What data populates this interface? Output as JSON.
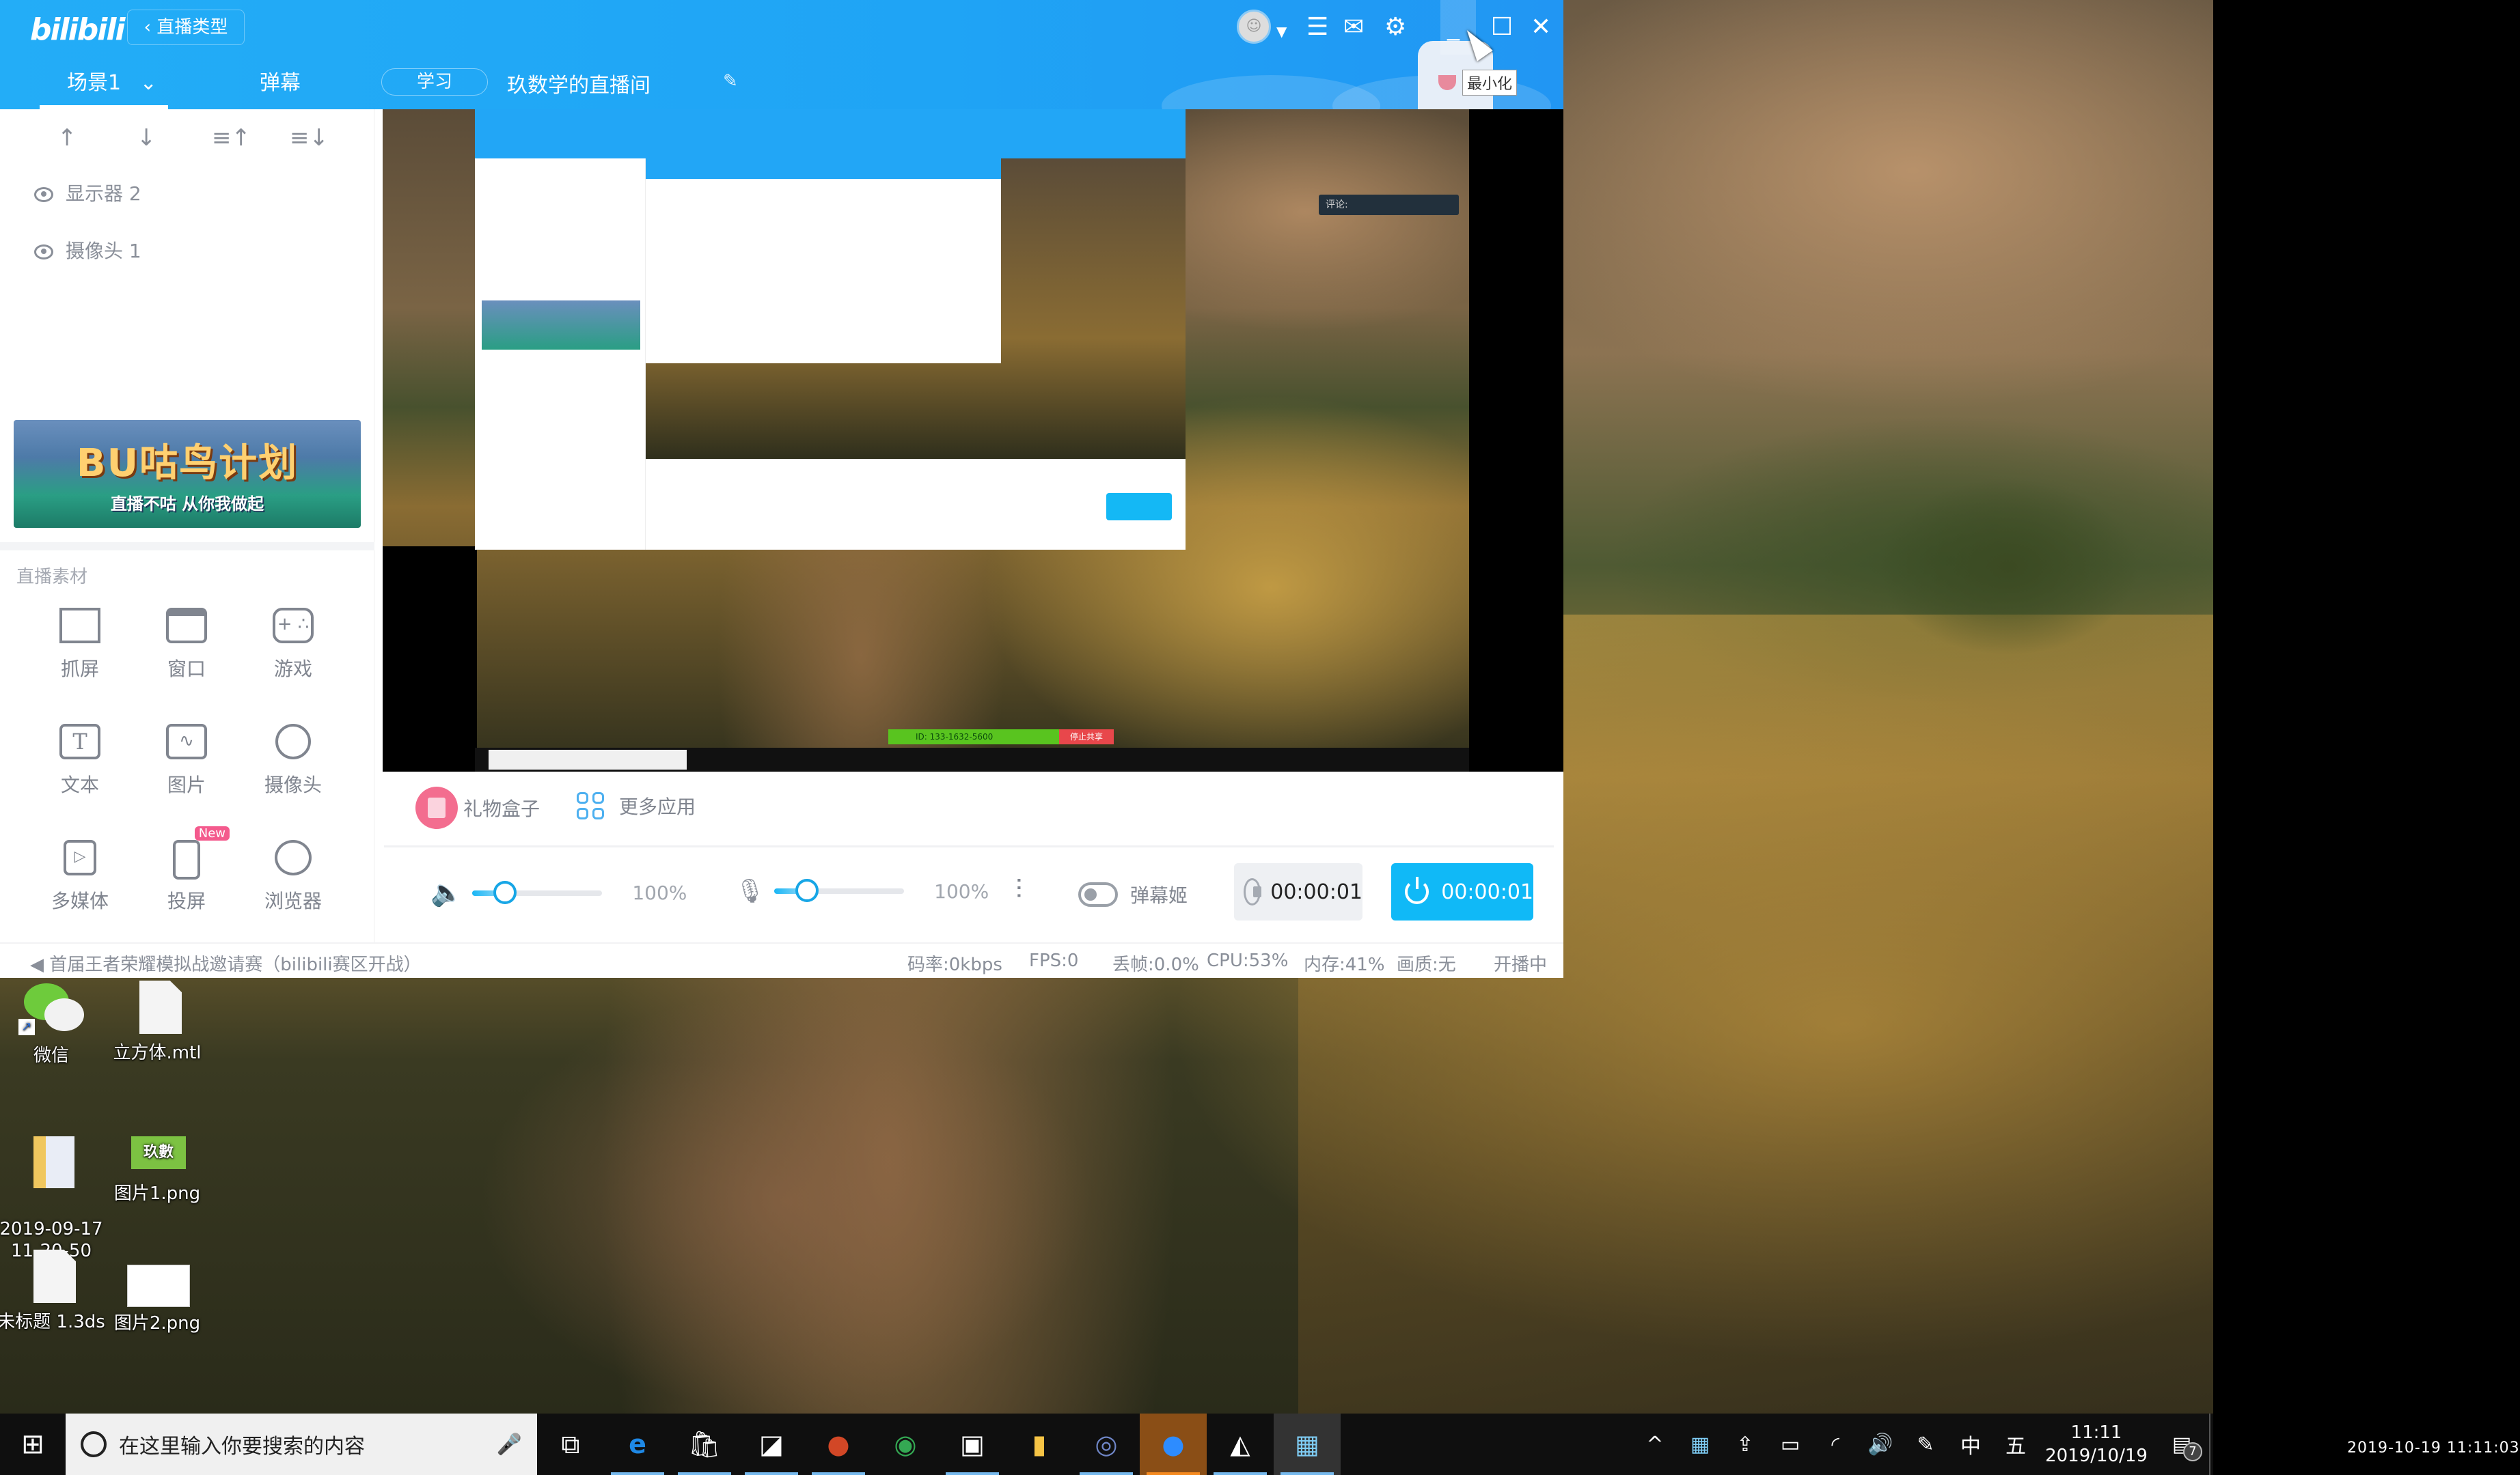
{
  "app": {
    "logo": "bilibili",
    "back_button": "直播类型",
    "tabs": [
      {
        "label": "场景1",
        "active": true,
        "has_dropdown": true
      },
      {
        "label": "弹幕",
        "active": false
      }
    ],
    "category": "学习",
    "room_title": "玖数学的直播间",
    "header_icons": [
      "avatar",
      "caret-down-icon",
      "menu-icon",
      "mail-icon",
      "gear-icon"
    ],
    "window_controls": [
      "minimize-icon",
      "maximize-icon",
      "close-icon"
    ],
    "tooltip": "最小化"
  },
  "layer_toolbar": [
    "move-up-icon",
    "move-down-icon",
    "move-top-icon",
    "move-bottom-icon"
  ],
  "layers": [
    {
      "label": "显示器 2",
      "visible": true
    },
    {
      "label": "摄像头 1",
      "visible": true
    }
  ],
  "banner": {
    "title": "BU咕鸟计划",
    "subtitle": "直播不咕 从你我做起"
  },
  "materials": {
    "title": "直播素材",
    "items": [
      {
        "label": "抓屏",
        "icon": "crop-icon"
      },
      {
        "label": "窗口",
        "icon": "window-icon"
      },
      {
        "label": "游戏",
        "icon": "gamepad-icon"
      },
      {
        "label": "文本",
        "icon": "text-icon"
      },
      {
        "label": "图片",
        "icon": "image-icon"
      },
      {
        "label": "摄像头",
        "icon": "webcam-icon"
      },
      {
        "label": "多媒体",
        "icon": "media-file-icon"
      },
      {
        "label": "投屏",
        "icon": "phone-icon",
        "badge": "New"
      },
      {
        "label": "浏览器",
        "icon": "planet-icon"
      }
    ]
  },
  "preview": {
    "inner_tooltip": "评论:",
    "zoom_meeting_id": "ID: 133-1632-5600",
    "zoom_stop_share": "停止共享"
  },
  "apps": {
    "gift_box": "礼物盒子",
    "more_apps": "更多应用"
  },
  "controls": {
    "speaker_volume": 100,
    "speaker_volume_label": "100%",
    "speaker_slider_fraction": 0.25,
    "mic_volume": 100,
    "mic_volume_label": "100%",
    "mic_slider_fraction": 0.25,
    "danmu_toggle_label": "弹幕姬",
    "danmu_toggle_on": false,
    "record_time": "00:00:01",
    "live_time": "00:00:01"
  },
  "status_bar": {
    "notice": "首届王者荣耀模拟战邀请赛（bilibili赛区开战）",
    "bitrate": "码率:0kbps",
    "fps": "FPS:0",
    "dropped": "丢帧:0.0%",
    "cpu": "CPU:53%",
    "memory": "内存:41%",
    "quality": "画质:无",
    "live_state": "开播中"
  },
  "desktop_icons": [
    {
      "label": "微信",
      "type": "wechat"
    },
    {
      "label": "立方体.mtl",
      "type": "file"
    },
    {
      "label": "2019-09-17\n11-20-50",
      "type": "folder"
    },
    {
      "label": "图片1.png",
      "type": "png"
    },
    {
      "label": "未标题 1.3ds",
      "type": "file"
    },
    {
      "label": "图片2.png",
      "type": "png2"
    }
  ],
  "taskbar": {
    "search_placeholder": "在这里输入你要搜索的内容",
    "apps": [
      "task-view",
      "edge",
      "store",
      "drawboard",
      "powerpoint",
      "chrome",
      "svg-tool",
      "file-explorer",
      "cinema4d",
      "zoom",
      "inkscape-like",
      "live-app"
    ],
    "tray": [
      "chevron-up-icon",
      "live-app-icon",
      "upload-icon",
      "battery-icon",
      "wifi-icon",
      "volume-icon",
      "pen-icon"
    ],
    "ime_lang": "中",
    "ime_mode": "五",
    "time": "11:11",
    "date": "2019/10/19",
    "notification_count": "7"
  },
  "recording_timestamp": "2019-10-19 11:11:03"
}
